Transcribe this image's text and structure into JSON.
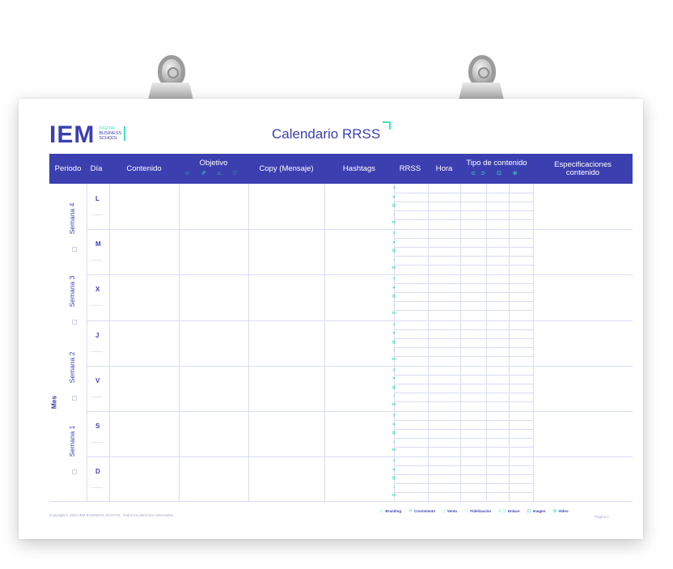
{
  "header": {
    "logo_main": "IEM",
    "logo_sub": [
      "DIGITAL",
      "BUSINESS",
      "SCHOOL"
    ],
    "title": "Calendario RRSS"
  },
  "columns": {
    "periodo": "Periodo",
    "dia": "Día",
    "contenido": "Contenido",
    "objetivo": "Objetivo",
    "objetivo_icons": "☆ ✐ ⌂ ♡",
    "copy": "Copy (Mensaje)",
    "hashtags": "Hashtags",
    "rrss": "RRSS",
    "hora": "Hora",
    "tipo": "Tipo de contenido",
    "tipo_icons": "⊂⊃ ⊡ ⊕",
    "especificaciones_1": "Especificaciones",
    "especificaciones_2": "contenido"
  },
  "days": [
    "L",
    "M",
    "X",
    "J",
    "V",
    "S",
    "D"
  ],
  "weeks": [
    "Semana 4",
    "Semana 3",
    "Semana 2",
    "Semana 1"
  ],
  "month_label": "Mes",
  "rrss_icons": [
    "f",
    "t-bird-icon",
    "instagram-icon",
    "tiktok-icon",
    "in"
  ],
  "rrss_glyphs": [
    "f",
    "♥",
    "◎",
    "♪",
    "in"
  ],
  "footer": {
    "copyright": "Copyright © 2021 IEM BUSINESS SCHOOL. Todos los derechos reservados.",
    "legend": [
      {
        "icon": "☆",
        "label": "Branding"
      },
      {
        "icon": "✐",
        "label": "Crecimiento"
      },
      {
        "icon": "⌂",
        "label": "Venta"
      },
      {
        "icon": "♡",
        "label": "Fidelización"
      },
      {
        "icon": "⊂⊃",
        "label": "Enlace"
      },
      {
        "icon": "⊡",
        "label": "Imagen"
      },
      {
        "icon": "⊕",
        "label": "Video"
      }
    ],
    "page": "Página 1"
  },
  "colors": {
    "primary": "#3b3fb0",
    "accent": "#3ee3c1"
  }
}
